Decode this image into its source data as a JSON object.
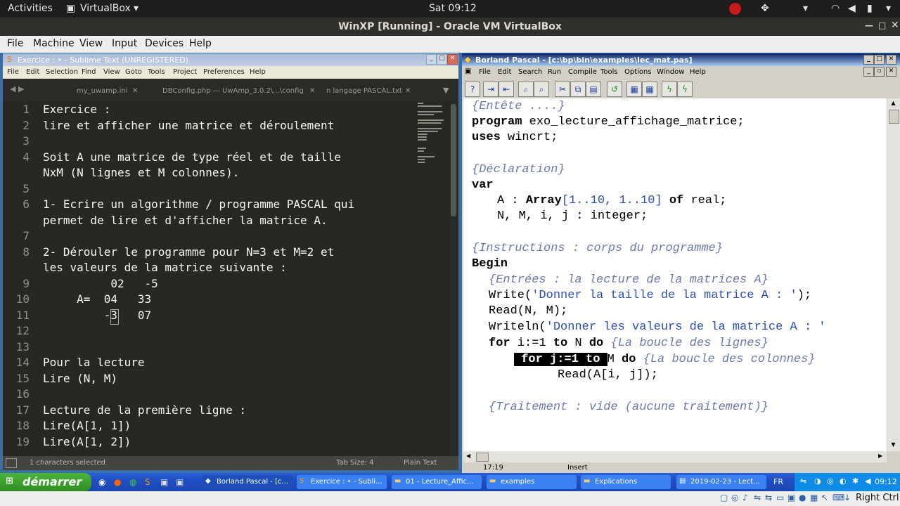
{
  "ubuntu": {
    "activities": "Activities",
    "app_name": "VirtualBox",
    "clock": "Sat 09:12"
  },
  "vbox": {
    "title": "WinXP [Running] - Oracle VM VirtualBox",
    "menu": [
      "File",
      "Machine",
      "View",
      "Input",
      "Devices",
      "Help"
    ],
    "host_key": "Right Ctrl"
  },
  "sublime": {
    "title": "Exercice : • - Sublime Text (UNREGISTERED)",
    "menu": [
      "File",
      "Edit",
      "Selection",
      "Find",
      "View",
      "Goto",
      "Tools",
      "Project",
      "Preferences",
      "Help"
    ],
    "tabs": [
      "my_uwamp.ini",
      "DBConfig.php — UwAmp_3.0.2\\...\\config",
      "n langage PASCAL.txt"
    ],
    "lines": [
      {
        "n": "1",
        "text": "Exercice :"
      },
      {
        "n": "2",
        "text": "lire et afficher une matrice et déroulement"
      },
      {
        "n": "3",
        "text": ""
      },
      {
        "n": "4",
        "text": "Soit A une matrice de type réel et de taille"
      },
      {
        "n": "",
        "text": "NxM (N lignes et M colonnes)."
      },
      {
        "n": "5",
        "text": ""
      },
      {
        "n": "6",
        "text": "1- Ecrire un algorithme / programme PASCAL qui"
      },
      {
        "n": "",
        "text": "permet de lire et d'afficher la matrice A."
      },
      {
        "n": "7",
        "text": ""
      },
      {
        "n": "8",
        "text": "2- Dérouler le programme pour N=3 et M=2 et"
      },
      {
        "n": "",
        "text": "les valeurs de la matrice suivante :"
      },
      {
        "n": "9",
        "text": "          02   -5"
      },
      {
        "n": "10",
        "text": "     A=  04   33"
      },
      {
        "n": "11",
        "text": "         -3   07"
      },
      {
        "n": "12",
        "text": ""
      },
      {
        "n": "13",
        "text": ""
      },
      {
        "n": "14",
        "text": "Pour la lecture"
      },
      {
        "n": "15",
        "text": "Lire (N, M)"
      },
      {
        "n": "16",
        "text": ""
      },
      {
        "n": "17",
        "text": "Lecture de la première ligne :"
      },
      {
        "n": "18",
        "text": "Lire(A[1, 1])"
      },
      {
        "n": "19",
        "text": "Lire(A[1, 2])"
      }
    ],
    "status_left": "1 characters selected",
    "tab_size": "Tab Size: 4",
    "syntax": "Plain Text"
  },
  "borland": {
    "title": "Borland Pascal - [c:\\bp\\bin\\examples\\lec_mat.pas]",
    "menu": [
      "File",
      "Edit",
      "Search",
      "Run",
      "Compile",
      "Tools",
      "Options",
      "Window",
      "Help"
    ],
    "code": {
      "c1": "{Entête ....}",
      "program_kw": "program",
      "program_name": " exo_lecture_affichage_matrice;",
      "uses_kw": "uses",
      "uses_name": " wincrt;",
      "c2": "{Déclaration}",
      "var_kw": "var",
      "a_decl_1": "A : ",
      "array_kw": "Array",
      "a_decl_2": "[1..10, 1..10] ",
      "of_kw": "of",
      "a_decl_3": " real;",
      "nm_decl": "N, M, i, j : integer;",
      "c3": "{Instructions : corps du programme}",
      "begin_kw": "Begin",
      "c4": "{Entrées : la lecture de la matrices A}",
      "write_1": "Write(",
      "write_str": "'Donner la taille de la matrice A : '",
      "write_2": ");",
      "read_nm": "Read(N, M);",
      "writeln_1": "Writeln(",
      "writeln_str": "'Donner les valeurs de la matrice A : '",
      "for_kw": "for",
      "for_i_1": " i:=1 ",
      "to_kw": "to",
      "for_i_2": " N ",
      "do_kw": "do",
      "c5": " {La boucle des lignes}",
      "for_j_sel": " for j:=1 to ",
      "for_j_rest": "M ",
      "c6": " {La boucle des colonnes}",
      "read_a": "Read(A[i, j]);",
      "c7": "{Traitement : vide (aucune traitement)}"
    },
    "cursor_pos": "17:19",
    "mode": "Insert"
  },
  "taskbar": {
    "start": "démarrer",
    "tasks": [
      "Borland Pascal - [c...",
      "Exercice : • - Subli...",
      "01 - Lecture_Affic...",
      "examples",
      "Explications",
      "2019-02-23 - Lect..."
    ],
    "lang": "FR",
    "clock": "09:12"
  }
}
